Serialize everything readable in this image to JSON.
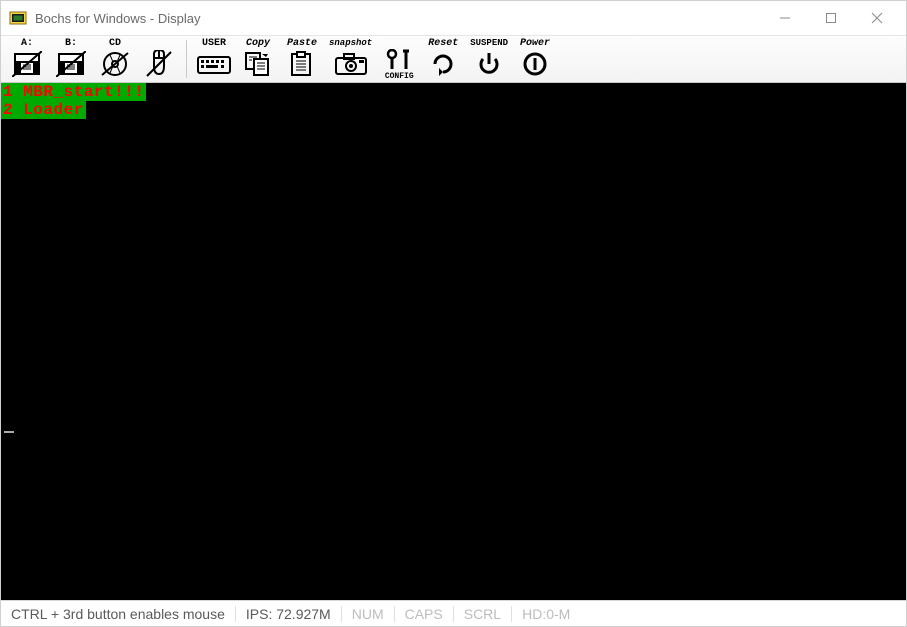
{
  "window": {
    "title": "Bochs for Windows - Display"
  },
  "toolbar": {
    "drive_a_label": "A:",
    "drive_b_label": "B:",
    "cd_label": "CD",
    "user_label": "USER",
    "copy_label": "Copy",
    "paste_label": "Paste",
    "snapshot_label": "snapshot",
    "config_label": "CONFIG",
    "reset_label": "Reset",
    "suspend_label": "SUSPEND",
    "power_label": "Power"
  },
  "console": {
    "lines": [
      "1 MBR_start!!!",
      "2 Loader"
    ]
  },
  "status": {
    "mouse_hint": "CTRL + 3rd button enables mouse",
    "ips": "IPS: 72.927M",
    "num": "NUM",
    "caps": "CAPS",
    "scrl": "SCRL",
    "hd": "HD:0-M"
  }
}
